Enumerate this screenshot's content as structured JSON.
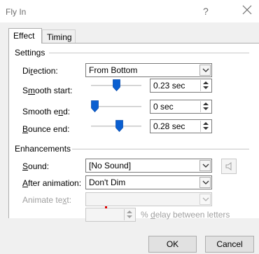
{
  "dialog": {
    "title": "Fly In",
    "help": "?"
  },
  "tabs": [
    "Effect",
    "Timing"
  ],
  "settings": {
    "group_label": "Settings",
    "direction": {
      "pre": "Di",
      "ul": "r",
      "post": "ection:",
      "value": "From Bottom"
    },
    "smooth_start": {
      "pre": "S",
      "ul": "m",
      "post": "ooth start:",
      "value": "0.23 sec",
      "level": 0.5
    },
    "smooth_end": {
      "pre": "Smooth e",
      "ul": "n",
      "post": "d:",
      "value": "0 sec",
      "level": 0.0
    },
    "bounce_end": {
      "pre": "",
      "ul": "B",
      "post": "ounce end:",
      "value": "0.28 sec",
      "level": 0.58
    }
  },
  "enhancements": {
    "group_label": "Enhancements",
    "sound": {
      "pre": "",
      "ul": "S",
      "post": "ound:",
      "value": "[No Sound]"
    },
    "after_animation": {
      "pre": "",
      "ul": "A",
      "post": "fter animation:",
      "value": "Don't Dim"
    },
    "animate_text": {
      "pre": "Animate te",
      "ul": "x",
      "post": "t:",
      "value": ""
    },
    "delay": {
      "value": "",
      "pre": "% ",
      "ul": "d",
      "post": "elay between letters"
    }
  },
  "buttons": {
    "ok": "OK",
    "cancel": "Cancel"
  }
}
